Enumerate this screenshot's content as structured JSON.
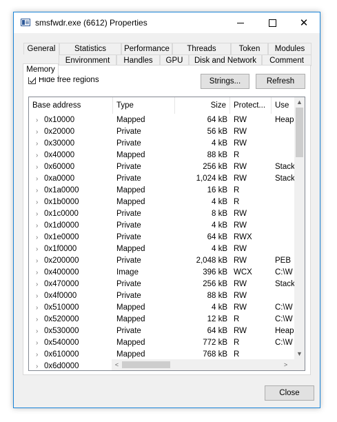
{
  "window": {
    "title": "smsfwdr.exe (6612) Properties",
    "close_glyph": "✕"
  },
  "tabs_row1": [
    "General",
    "Statistics",
    "Performance",
    "Threads",
    "Token",
    "Modules"
  ],
  "tabs_row2": [
    "Memory",
    "Environment",
    "Handles",
    "GPU",
    "Disk and Network",
    "Comment"
  ],
  "active_tab": "Memory",
  "options": {
    "hide_free_regions_label": "Hide free regions",
    "hide_free_regions_checked": true
  },
  "buttons": {
    "strings": "Strings...",
    "refresh": "Refresh",
    "close": "Close"
  },
  "table": {
    "columns": [
      "Base address",
      "Type",
      "Size",
      "Protect...",
      "Use"
    ],
    "rows": [
      {
        "addr": "0x10000",
        "type": "Mapped",
        "size": "64 kB",
        "prot": "RW",
        "use": "Heap"
      },
      {
        "addr": "0x20000",
        "type": "Private",
        "size": "56 kB",
        "prot": "RW",
        "use": ""
      },
      {
        "addr": "0x30000",
        "type": "Private",
        "size": "4 kB",
        "prot": "RW",
        "use": ""
      },
      {
        "addr": "0x40000",
        "type": "Mapped",
        "size": "88 kB",
        "prot": "R",
        "use": ""
      },
      {
        "addr": "0x60000",
        "type": "Private",
        "size": "256 kB",
        "prot": "RW",
        "use": "Stack"
      },
      {
        "addr": "0xa0000",
        "type": "Private",
        "size": "1,024 kB",
        "prot": "RW",
        "use": "Stack"
      },
      {
        "addr": "0x1a0000",
        "type": "Mapped",
        "size": "16 kB",
        "prot": "R",
        "use": ""
      },
      {
        "addr": "0x1b0000",
        "type": "Mapped",
        "size": "4 kB",
        "prot": "R",
        "use": ""
      },
      {
        "addr": "0x1c0000",
        "type": "Private",
        "size": "8 kB",
        "prot": "RW",
        "use": ""
      },
      {
        "addr": "0x1d0000",
        "type": "Private",
        "size": "4 kB",
        "prot": "RW",
        "use": ""
      },
      {
        "addr": "0x1e0000",
        "type": "Private",
        "size": "64 kB",
        "prot": "RWX",
        "use": ""
      },
      {
        "addr": "0x1f0000",
        "type": "Mapped",
        "size": "4 kB",
        "prot": "RW",
        "use": ""
      },
      {
        "addr": "0x200000",
        "type": "Private",
        "size": "2,048 kB",
        "prot": "RW",
        "use": "PEB"
      },
      {
        "addr": "0x400000",
        "type": "Image",
        "size": "396 kB",
        "prot": "WCX",
        "use": "C:\\W"
      },
      {
        "addr": "0x470000",
        "type": "Private",
        "size": "256 kB",
        "prot": "RW",
        "use": "Stack"
      },
      {
        "addr": "0x4f0000",
        "type": "Private",
        "size": "88 kB",
        "prot": "RW",
        "use": ""
      },
      {
        "addr": "0x510000",
        "type": "Mapped",
        "size": "4 kB",
        "prot": "RW",
        "use": "C:\\W"
      },
      {
        "addr": "0x520000",
        "type": "Mapped",
        "size": "12 kB",
        "prot": "R",
        "use": "C:\\W"
      },
      {
        "addr": "0x530000",
        "type": "Private",
        "size": "64 kB",
        "prot": "RW",
        "use": "Heap"
      },
      {
        "addr": "0x540000",
        "type": "Mapped",
        "size": "772 kB",
        "prot": "R",
        "use": "C:\\W"
      },
      {
        "addr": "0x610000",
        "type": "Mapped",
        "size": "768 kB",
        "prot": "R",
        "use": ""
      },
      {
        "addr": "0x6d0000",
        "type": "",
        "size": "",
        "prot": "",
        "use": ""
      }
    ]
  },
  "icons": {
    "expander": "›",
    "scroll_up": "▲",
    "scroll_down": "▼",
    "scroll_left": "<",
    "scroll_right": ">"
  },
  "colors": {
    "accent_border": "#1883d7",
    "window_bg": "#f0f0f0"
  }
}
